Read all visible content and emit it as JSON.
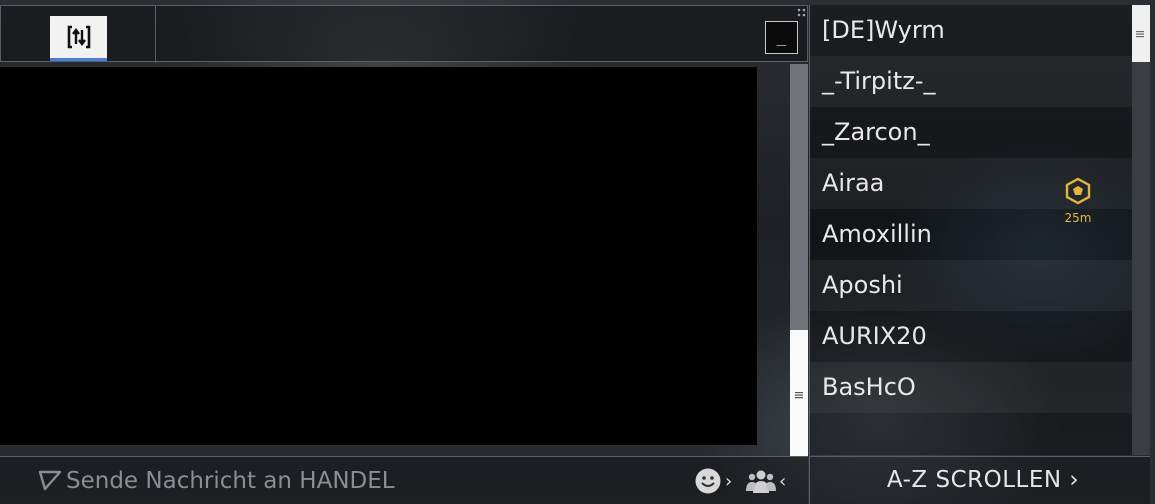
{
  "window": {
    "minimize_label": "_"
  },
  "input": {
    "placeholder": "Sende Nachricht an HANDEL"
  },
  "user_list": {
    "users": [
      {
        "name": "[DE]Wyrm"
      },
      {
        "name": "_-Tirpitz-_"
      },
      {
        "name": "_Zarcon_"
      },
      {
        "name": "Airaa",
        "badge": {
          "icon": "gold-diamond-badge-icon",
          "time": "25m"
        }
      },
      {
        "name": "Amoxillin"
      },
      {
        "name": "Aposhi"
      },
      {
        "name": "AURIX20"
      },
      {
        "name": "BasHcO"
      }
    ]
  },
  "sort_button": {
    "label": "A-Z SCROLLEN",
    "chevron": "›"
  },
  "icons": {
    "tab": "swap-arrows-icon",
    "input": "triangle-arrow-icon",
    "emoji": "smiley-icon",
    "users": "users-group-icon"
  },
  "colors": {
    "accent_blue": "#4a7fd6",
    "badge_gold": "#e2b73a",
    "placeholder_gray": "#8a8d92"
  }
}
